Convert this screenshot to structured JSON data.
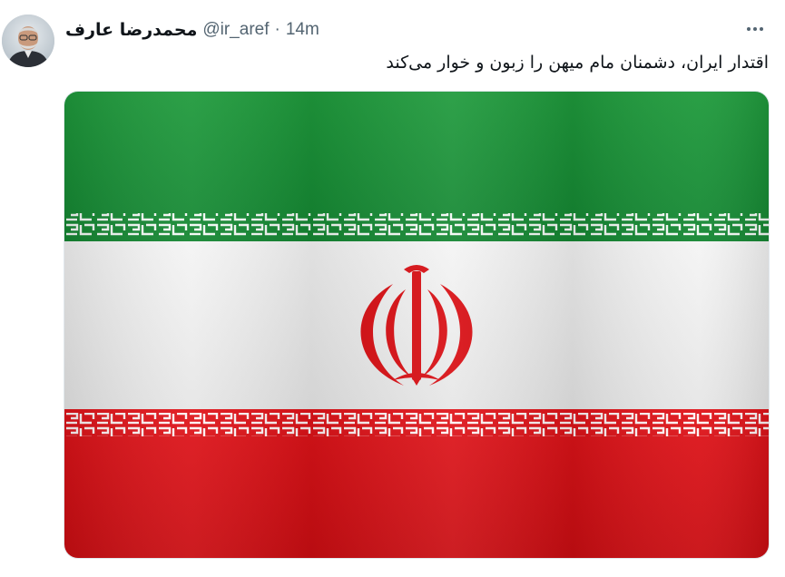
{
  "tweet": {
    "author": {
      "display_name": "محمدرضا عارف",
      "handle": "@ir_aref",
      "avatar_icon": "user-avatar"
    },
    "separator": "·",
    "timestamp": "14m",
    "more_icon": "more-horizontal-icon",
    "text": "اقتدار ایران، دشمنان مام میهن را زبون و خوار می‌کند",
    "media": {
      "type": "image",
      "subject": "flag-of-iran",
      "colors": {
        "green": "#239f40",
        "white": "#ffffff",
        "red": "#da0000"
      }
    }
  },
  "theme": {
    "text_primary": "#0f1419",
    "text_secondary": "#536471"
  }
}
